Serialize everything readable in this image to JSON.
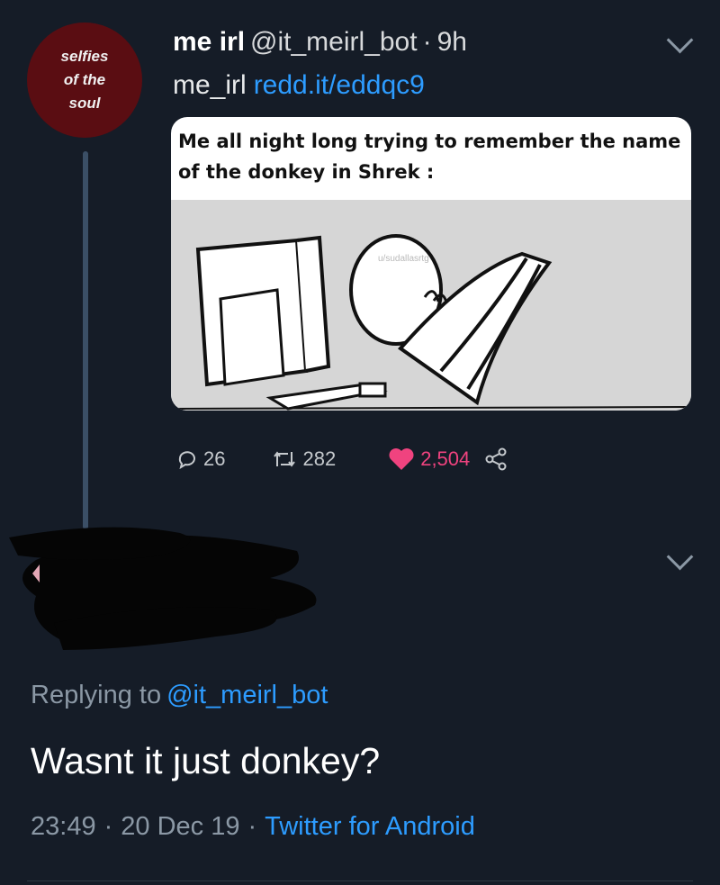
{
  "tweet": {
    "avatar_text": [
      "selfies",
      "of the",
      "soul"
    ],
    "display_name": "me irl",
    "handle": "@it_meirl_bot",
    "separator": "·",
    "time": "9h",
    "text": "me_irl",
    "link": "redd.it/eddqc9",
    "meme": {
      "caption": "Me all night long trying to remember the name of the donkey in Shrek :",
      "watermark": "u/sudallasrtg"
    },
    "stats": {
      "replies": "26",
      "retweets": "282",
      "likes": "2,504"
    }
  },
  "reply": {
    "replying_label": "Replying to",
    "replying_to": "@it_meirl_bot",
    "text": "Wasnt it just donkey?",
    "time": "23:49",
    "date": "20 Dec 19",
    "separator": "·",
    "client": "Twitter for Android"
  },
  "colors": {
    "background": "#151c27",
    "link": "#2d9cff",
    "like": "#f0437f",
    "avatar": "#5a0d12"
  },
  "icons": [
    "reply-icon",
    "retweet-icon",
    "heart-icon",
    "share-icon",
    "chevron-down-icon"
  ]
}
